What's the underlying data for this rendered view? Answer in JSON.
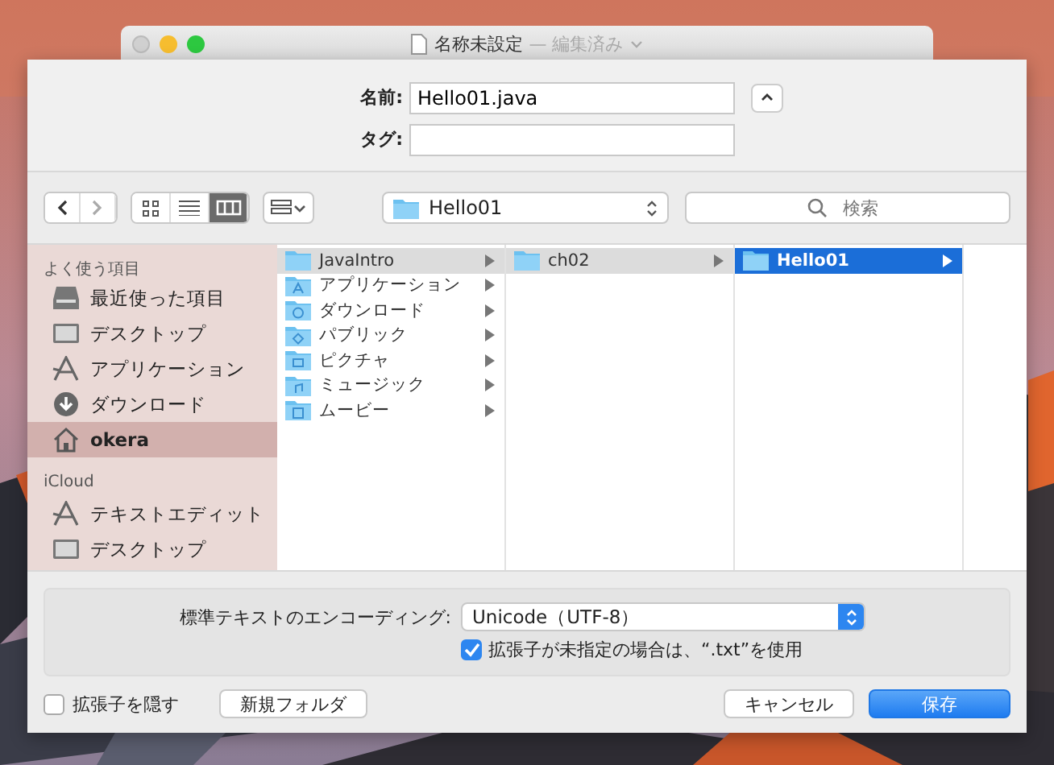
{
  "window": {
    "title": "名称未設定",
    "subtitle": "— 編集済み"
  },
  "name_field": {
    "label": "名前:",
    "value": "Hello01.java"
  },
  "tags_field": {
    "label": "タグ:"
  },
  "toolbar": {
    "view_modes": [
      {
        "kind": "icons",
        "selected": false
      },
      {
        "kind": "list",
        "selected": false
      },
      {
        "kind": "columns",
        "selected": true
      }
    ],
    "path": "Hello01",
    "search": {
      "placeholder": "検索"
    }
  },
  "sidebar": {
    "sections": [
      {
        "heading": "よく使う項目",
        "items": [
          {
            "label": "最近使った項目",
            "kind": "recents",
            "selected": false
          },
          {
            "label": "デスクトップ",
            "kind": "desktop",
            "selected": false
          },
          {
            "label": "アプリケーション",
            "kind": "apps",
            "selected": false
          },
          {
            "label": "ダウンロード",
            "kind": "downloads",
            "selected": false
          },
          {
            "label": "okera",
            "kind": "home",
            "selected": true
          }
        ]
      },
      {
        "heading": "iCloud",
        "items": [
          {
            "label": "テキストエディット",
            "kind": "apps",
            "selected": false
          },
          {
            "label": "デスクトップ",
            "kind": "desktop",
            "selected": false
          }
        ]
      }
    ]
  },
  "columns": [
    {
      "focused": false,
      "items": [
        {
          "label": "JavaIntro",
          "kind": "folder",
          "selected": true
        },
        {
          "label": "アプリケーション",
          "kind": "apps",
          "selected": false
        },
        {
          "label": "ダウンロード",
          "kind": "downloads",
          "selected": false
        },
        {
          "label": "パブリック",
          "kind": "public",
          "selected": false
        },
        {
          "label": "ピクチャ",
          "kind": "pictures",
          "selected": false
        },
        {
          "label": "ミュージック",
          "kind": "music",
          "selected": false
        },
        {
          "label": "ムービー",
          "kind": "movies",
          "selected": false
        }
      ]
    },
    {
      "focused": false,
      "items": [
        {
          "label": "ch02",
          "kind": "folder",
          "selected": true
        }
      ]
    },
    {
      "focused": true,
      "items": [
        {
          "label": "Hello01",
          "kind": "folder",
          "selected": true
        }
      ]
    }
  ],
  "options": {
    "encoding_label": "標準テキストのエンコーディング:",
    "encoding": "Unicode（UTF-8）",
    "use_txt": {
      "label": "拡張子が未指定の場合は、“.txt”を使用",
      "checked": true
    }
  },
  "hide_extension": {
    "label": "拡張子を隠す",
    "checked": false
  },
  "buttons": [
    {
      "label": "新規フォルダ",
      "kind": "secondary"
    },
    {
      "label": "キャンセル",
      "kind": "secondary"
    },
    {
      "label": "保存",
      "kind": "primary"
    }
  ]
}
